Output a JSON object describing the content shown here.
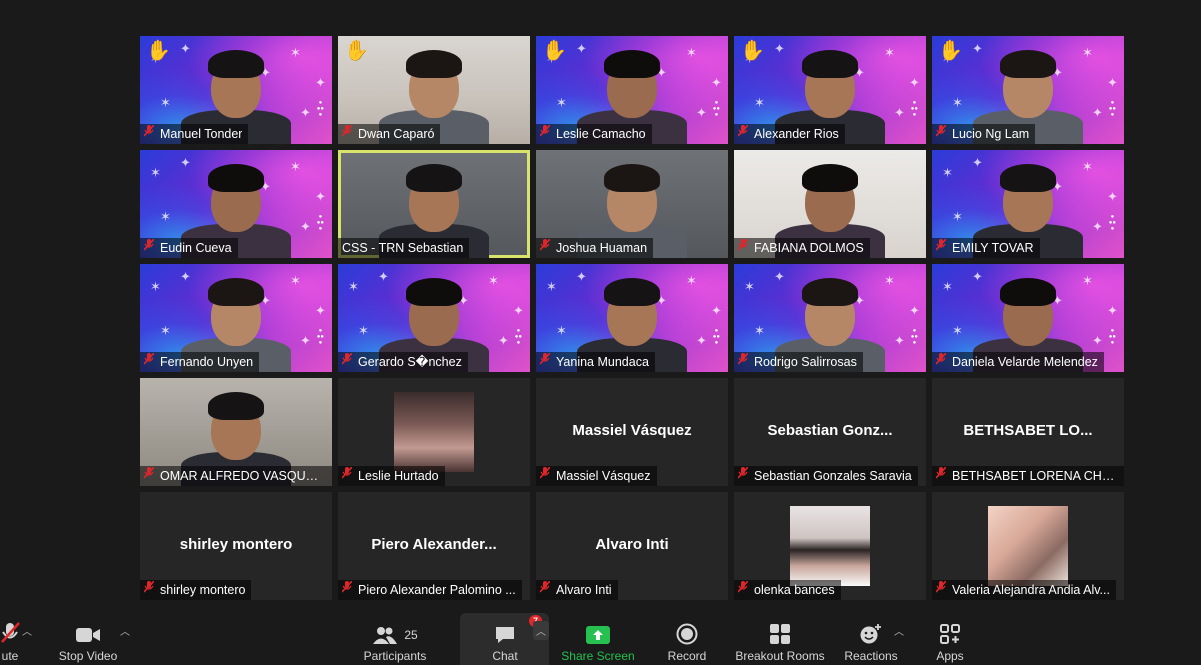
{
  "participants": [
    {
      "name": "Manuel Tonder",
      "muted": true,
      "hand": true,
      "bg": "xmas"
    },
    {
      "name": "Dwan Caparó",
      "muted": true,
      "hand": true,
      "bg": "room"
    },
    {
      "name": "Leslie Camacho",
      "muted": true,
      "hand": true,
      "bg": "xmas"
    },
    {
      "name": "Alexander Rios",
      "muted": true,
      "hand": true,
      "bg": "xmas"
    },
    {
      "name": "Lucio Ng Lam",
      "muted": true,
      "hand": true,
      "bg": "xmas"
    },
    {
      "name": "Eudin Cueva",
      "muted": true,
      "bg": "xmas"
    },
    {
      "name": "CSS  - TRN Sebastian",
      "muted": false,
      "active": true,
      "bg": "room2"
    },
    {
      "name": "Joshua Huaman",
      "muted": true,
      "bg": "room2"
    },
    {
      "name": "FABIANA DOLMOS",
      "muted": true,
      "bg": "room3"
    },
    {
      "name": "EMILY TOVAR",
      "muted": true,
      "bg": "xmas"
    },
    {
      "name": "Fernando Unyen",
      "muted": true,
      "bg": "xmas"
    },
    {
      "name": "Gerardo S�nchez",
      "muted": true,
      "bg": "xmas"
    },
    {
      "name": "Yanina Mundaca",
      "muted": true,
      "bg": "xmas"
    },
    {
      "name": "Rodrigo Salirrosas",
      "muted": true,
      "bg": "xmas"
    },
    {
      "name": "Daniela Velarde Melendez",
      "muted": true,
      "bg": "xmas"
    },
    {
      "name": "OMAR ALFREDO VASQUEZ...",
      "muted": true,
      "bg": "room4"
    },
    {
      "name": "Leslie Hurtado",
      "muted": true,
      "thumb": "photo1"
    },
    {
      "name": "Massiel Vásquez",
      "muted": true,
      "big": "Massiel Vásquez"
    },
    {
      "name": "Sebastian Gonzales Saravia",
      "muted": true,
      "big": "Sebastian  Gonz..."
    },
    {
      "name": "BETHSABET LORENA CHAL...",
      "muted": true,
      "big": "BETHSABET  LO..."
    },
    {
      "name": "shirley montero",
      "muted": true,
      "big": "shirley montero"
    },
    {
      "name": "Piero Alexander Palomino ...",
      "muted": true,
      "big": "Piero  Alexander..."
    },
    {
      "name": "Alvaro Inti",
      "muted": true,
      "big": "Alvaro Inti"
    },
    {
      "name": "olenka bances",
      "muted": true,
      "thumb": "photo2"
    },
    {
      "name": "Valeria Alejandra Andia Alv...",
      "muted": true,
      "thumb": "photo3"
    }
  ],
  "toolbar": {
    "unmute_label": "ute",
    "stop_video_label": "Stop Video",
    "participants_label": "Participants",
    "participants_count": "25",
    "chat_label": "Chat",
    "chat_badge": "7",
    "share_label": "Share Screen",
    "record_label": "Record",
    "breakout_label": "Breakout Rooms",
    "reactions_label": "Reactions",
    "apps_label": "Apps"
  },
  "colors": {
    "accent_green": "#25c050",
    "mute_red": "#e0262a",
    "active_border": "#d7e36a"
  }
}
